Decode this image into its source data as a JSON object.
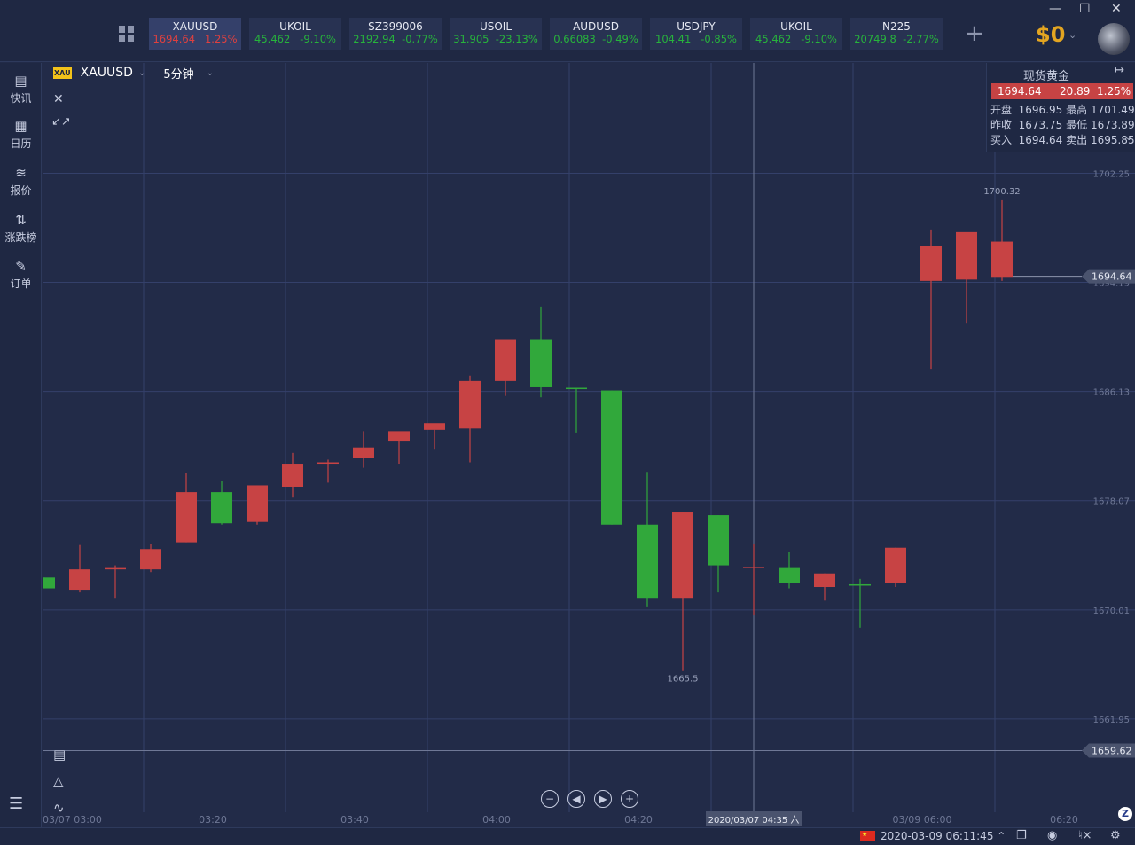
{
  "tickers": [
    {
      "symbol": "XAUUSD",
      "price": "1694.64",
      "change": "1.25%",
      "dir": "up",
      "active": true
    },
    {
      "symbol": "UKOIL",
      "price": "45.462",
      "change": "-9.10%",
      "dir": "down",
      "active": false
    },
    {
      "symbol": "SZ399006",
      "price": "2192.94",
      "change": "-0.77%",
      "dir": "down",
      "active": false
    },
    {
      "symbol": "USOIL",
      "price": "31.905",
      "change": "-23.13%",
      "dir": "down",
      "active": false
    },
    {
      "symbol": "AUDUSD",
      "price": "0.66083",
      "change": "-0.49%",
      "dir": "down",
      "active": false
    },
    {
      "symbol": "USDJPY",
      "price": "104.41",
      "change": "-0.85%",
      "dir": "down",
      "active": false
    },
    {
      "symbol": "UKOIL",
      "price": "45.462",
      "change": "-9.10%",
      "dir": "down",
      "active": false
    },
    {
      "symbol": "N225",
      "price": "20749.8",
      "change": "-2.77%",
      "dir": "down",
      "active": false
    }
  ],
  "header": {
    "add_icon": "plus",
    "balance": "$0",
    "window_controls": [
      "—",
      "☐",
      "✕"
    ]
  },
  "sidebar": {
    "items": [
      {
        "label": "快讯",
        "icon": "news-icon"
      },
      {
        "label": "日历",
        "icon": "calendar-icon"
      },
      {
        "label": "报价",
        "icon": "trend-icon"
      },
      {
        "label": "涨跌榜",
        "icon": "sort-icon"
      },
      {
        "label": "订单",
        "icon": "order-icon"
      }
    ],
    "menu_icon": "menu-icon"
  },
  "chart_header": {
    "badge": "XAU",
    "symbol": "XAUUSD",
    "interval": "5分钟"
  },
  "info_panel": {
    "title": "现货黄金",
    "price": "1694.64",
    "change": "20.89",
    "change_pct": "1.25%",
    "open_label": "开盘",
    "open": "1696.95",
    "high_label": "最高",
    "high": "1701.49",
    "prev_label": "昨收",
    "prev": "1673.75",
    "low_label": "最低",
    "low": "1673.89",
    "bid_label": "买入",
    "bid": "1694.64",
    "ask_label": "卖出",
    "ask": "1695.85"
  },
  "chart_data": {
    "type": "candlestick",
    "up_color": "#c74344",
    "down_color": "#31a83b",
    "y_ticks": [
      "1702.25",
      "1694.19",
      "1686.13",
      "1678.07",
      "1670.01",
      "1661.95"
    ],
    "ylim": [
      1659.62,
      1710.3
    ],
    "x_labels": [
      "03/07 03:00",
      "03:20",
      "03:40",
      "04:00",
      "04:20",
      "03/09 06:00",
      "06:20"
    ],
    "crosshair_time": "2020/03/07 04:35 六",
    "price_tags": [
      "1694.64",
      "1659.62"
    ],
    "annotations": [
      {
        "text": "1700.32",
        "candle": 27,
        "at": "high"
      },
      {
        "text": "1665.5",
        "candle": 18,
        "at": "low"
      }
    ],
    "candles": [
      {
        "o": 1672.4,
        "h": 1672.4,
        "l": 1671.6,
        "c": 1671.6
      },
      {
        "o": 1671.5,
        "h": 1674.8,
        "l": 1671.3,
        "c": 1673.0
      },
      {
        "o": 1673.0,
        "h": 1673.3,
        "l": 1670.9,
        "c": 1673.1
      },
      {
        "o": 1673.0,
        "h": 1674.9,
        "l": 1672.8,
        "c": 1674.5
      },
      {
        "o": 1675.0,
        "h": 1680.1,
        "l": 1675.0,
        "c": 1678.7
      },
      {
        "o": 1678.7,
        "h": 1679.5,
        "l": 1676.3,
        "c": 1676.4
      },
      {
        "o": 1676.5,
        "h": 1679.2,
        "l": 1676.3,
        "c": 1679.2
      },
      {
        "o": 1679.1,
        "h": 1681.6,
        "l": 1678.3,
        "c": 1680.8
      },
      {
        "o": 1680.8,
        "h": 1681.1,
        "l": 1679.4,
        "c": 1680.9
      },
      {
        "o": 1681.2,
        "h": 1683.2,
        "l": 1680.5,
        "c": 1682.0
      },
      {
        "o": 1682.5,
        "h": 1683.0,
        "l": 1680.8,
        "c": 1683.2
      },
      {
        "o": 1683.3,
        "h": 1683.3,
        "l": 1681.9,
        "c": 1683.8
      },
      {
        "o": 1683.4,
        "h": 1687.3,
        "l": 1680.9,
        "c": 1686.9
      },
      {
        "o": 1686.9,
        "h": 1689.7,
        "l": 1685.8,
        "c": 1690.0
      },
      {
        "o": 1690.0,
        "h": 1692.4,
        "l": 1685.7,
        "c": 1686.5
      },
      {
        "o": 1686.4,
        "h": 1686.4,
        "l": 1683.1,
        "c": 1686.3
      },
      {
        "o": 1686.2,
        "h": 1686.2,
        "l": 1676.3,
        "c": 1676.3
      },
      {
        "o": 1676.3,
        "h": 1680.2,
        "l": 1670.2,
        "c": 1670.9
      },
      {
        "o": 1670.9,
        "h": 1677.2,
        "l": 1665.5,
        "c": 1677.2
      },
      {
        "o": 1677.0,
        "h": 1677.0,
        "l": 1671.3,
        "c": 1673.3
      },
      {
        "o": 1673.2,
        "h": 1674.9,
        "l": 1669.6,
        "c": 1673.2
      },
      {
        "o": 1673.1,
        "h": 1674.3,
        "l": 1671.6,
        "c": 1672.0
      },
      {
        "o": 1671.7,
        "h": 1672.7,
        "l": 1670.7,
        "c": 1672.7
      },
      {
        "o": 1671.9,
        "h": 1672.3,
        "l": 1668.7,
        "c": 1671.8
      },
      {
        "o": 1672.0,
        "h": 1674.6,
        "l": 1671.7,
        "c": 1674.6
      },
      {
        "o": 1694.3,
        "h": 1698.1,
        "l": 1687.8,
        "c": 1696.9
      },
      {
        "o": 1694.4,
        "h": 1697.5,
        "l": 1691.2,
        "c": 1697.9
      },
      {
        "o": 1694.6,
        "h": 1700.32,
        "l": 1694.3,
        "c": 1697.2
      }
    ]
  },
  "status_bar": {
    "flag": "China",
    "datetime": "2020-03-09 06:11:45"
  }
}
